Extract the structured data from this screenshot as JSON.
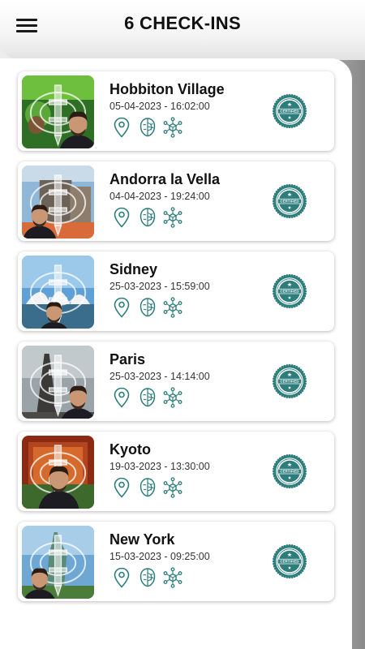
{
  "header": {
    "title": "6 CHECK-INS",
    "menu_icon": "hamburger-menu-icon"
  },
  "colors": {
    "accent": "#2e7d7d",
    "text": "#111111"
  },
  "checkins": [
    {
      "place": "Hobbiton Village",
      "datetime": "05-04-2023 - 16:02:00",
      "badge": "CERTIFIED",
      "photo": "hobbiton-selfie-photo"
    },
    {
      "place": "Andorra la Vella",
      "datetime": "04-04-2023 - 19:24:00",
      "badge": "CERTIFIED",
      "photo": "andorra-selfie-photo"
    },
    {
      "place": "Sidney",
      "datetime": "25-03-2023 - 15:59:00",
      "badge": "CERTIFIED",
      "photo": "sidney-opera-house-selfie-photo"
    },
    {
      "place": "Paris",
      "datetime": "25-03-2023 - 14:14:00",
      "badge": "CERTIFIED",
      "photo": "paris-eiffel-tower-selfie-photo"
    },
    {
      "place": "Kyoto",
      "datetime": "19-03-2023 - 13:30:00",
      "badge": "CERTIFIED",
      "photo": "kyoto-selfie-photo"
    },
    {
      "place": "New York",
      "datetime": "15-03-2023 - 09:25:00",
      "badge": "CERTIFIED",
      "photo": "new-york-statue-of-liberty-selfie-photo"
    }
  ]
}
